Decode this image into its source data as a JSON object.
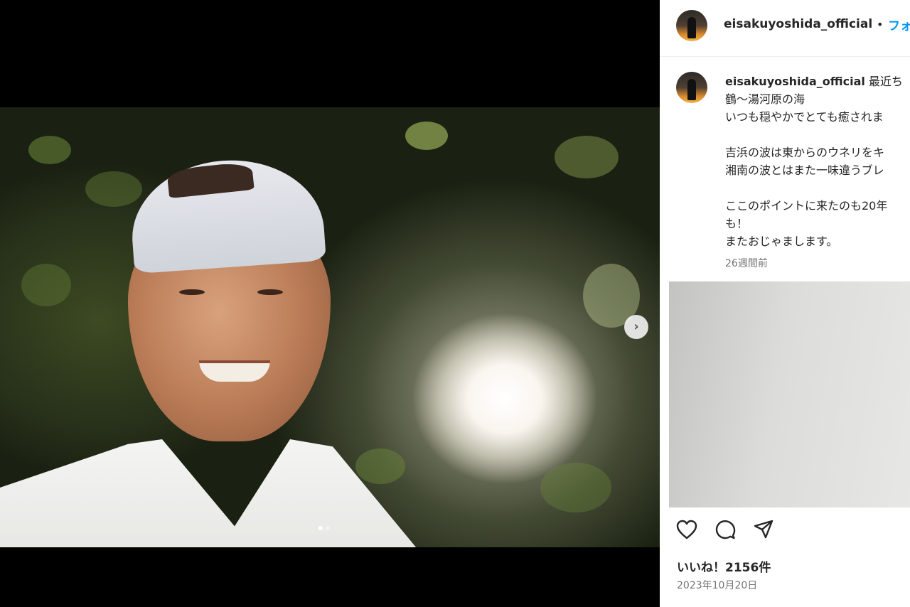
{
  "post": {
    "username": "eisakuyoshida_official",
    "separator": "•",
    "follow_label": "フォ"
  },
  "caption": {
    "username": "eisakuyoshida_official",
    "line1_rest": " 最近ち",
    "lines": [
      "鶴〜湯河原の海",
      "いつも穏やかでとても癒されま",
      "",
      "吉浜の波は東からのウネリをキ",
      "湘南の波とはまた一味違うブレ",
      "",
      "ここのポイントに来たのも20年",
      "も！",
      "またおじゃまします。"
    ],
    "time_ago": "26週間前"
  },
  "engagement": {
    "likes": "いいね！2156件",
    "date": "2023年10月20日"
  },
  "icons": [
    "heart-icon",
    "comment-icon",
    "share-icon",
    "chevron-right-icon"
  ],
  "colors": {
    "accent": "#0095f6",
    "text": "#262626",
    "muted": "#737373"
  }
}
